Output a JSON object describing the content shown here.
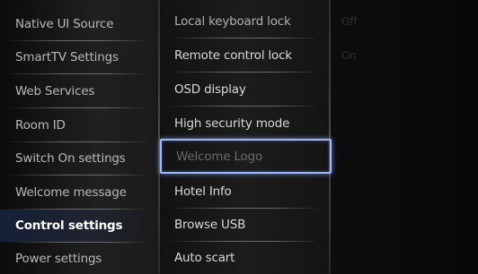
{
  "left_menu": {
    "items": [
      {
        "label": "Native UI Source"
      },
      {
        "label": "SmartTV Settings"
      },
      {
        "label": "Web Services"
      },
      {
        "label": "Room ID"
      },
      {
        "label": "Switch On settings"
      },
      {
        "label": "Welcome message"
      },
      {
        "label": "Control settings"
      },
      {
        "label": "Power settings"
      }
    ]
  },
  "sub_menu": {
    "items": [
      {
        "label": "Local keyboard lock"
      },
      {
        "label": "Remote control lock"
      },
      {
        "label": "OSD display"
      },
      {
        "label": "High security mode"
      },
      {
        "label": "Welcome Logo"
      },
      {
        "label": "Hotel Info"
      },
      {
        "label": "Browse USB"
      },
      {
        "label": "Auto scart"
      }
    ]
  },
  "options": {
    "items": [
      {
        "label": "Off"
      },
      {
        "label": "On"
      }
    ]
  }
}
